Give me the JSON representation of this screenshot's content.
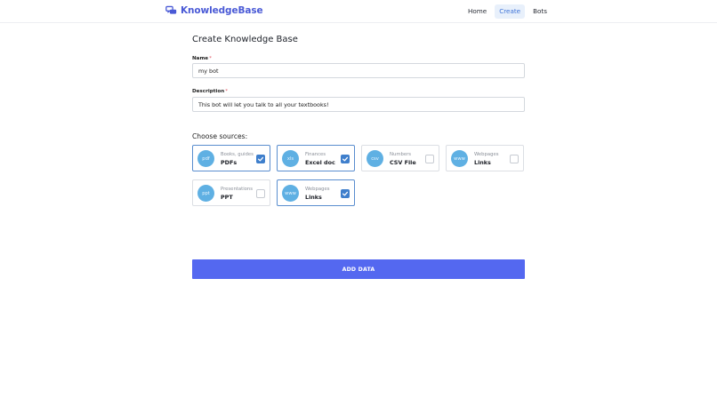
{
  "header": {
    "brand": "KnowledgeBase",
    "brand_icon": "chat-bubbles-icon",
    "accent_color": "#4a5ad6",
    "nav": [
      {
        "label": "Home",
        "active": false
      },
      {
        "label": "Create",
        "active": true
      },
      {
        "label": "Bots",
        "active": false
      }
    ]
  },
  "form": {
    "title": "Create Knowledge Base",
    "name": {
      "label": "Name",
      "required_mark": "*",
      "value": "my bot"
    },
    "description": {
      "label": "Description",
      "required_mark": "*",
      "value": "This bot will let you talk to all your textbooks!"
    }
  },
  "sources": {
    "title": "Choose sources:",
    "items": [
      {
        "icon_text": "pdf",
        "sub": "Books, guides",
        "label": "PDFs",
        "checked": true
      },
      {
        "icon_text": "xls",
        "sub": "Finances",
        "label": "Excel doc",
        "checked": true
      },
      {
        "icon_text": "csv",
        "sub": "Numbers",
        "label": "CSV File",
        "checked": false
      },
      {
        "icon_text": "www",
        "sub": "Webpages",
        "label": "Links",
        "checked": false
      },
      {
        "icon_text": "ppt",
        "sub": "Presentations",
        "label": "PPT",
        "checked": false
      },
      {
        "icon_text": "www",
        "sub": "Webpages",
        "label": "Links",
        "checked": true
      }
    ]
  },
  "actions": {
    "add_data": "ADD DATA",
    "button_color": "#5468f0"
  }
}
